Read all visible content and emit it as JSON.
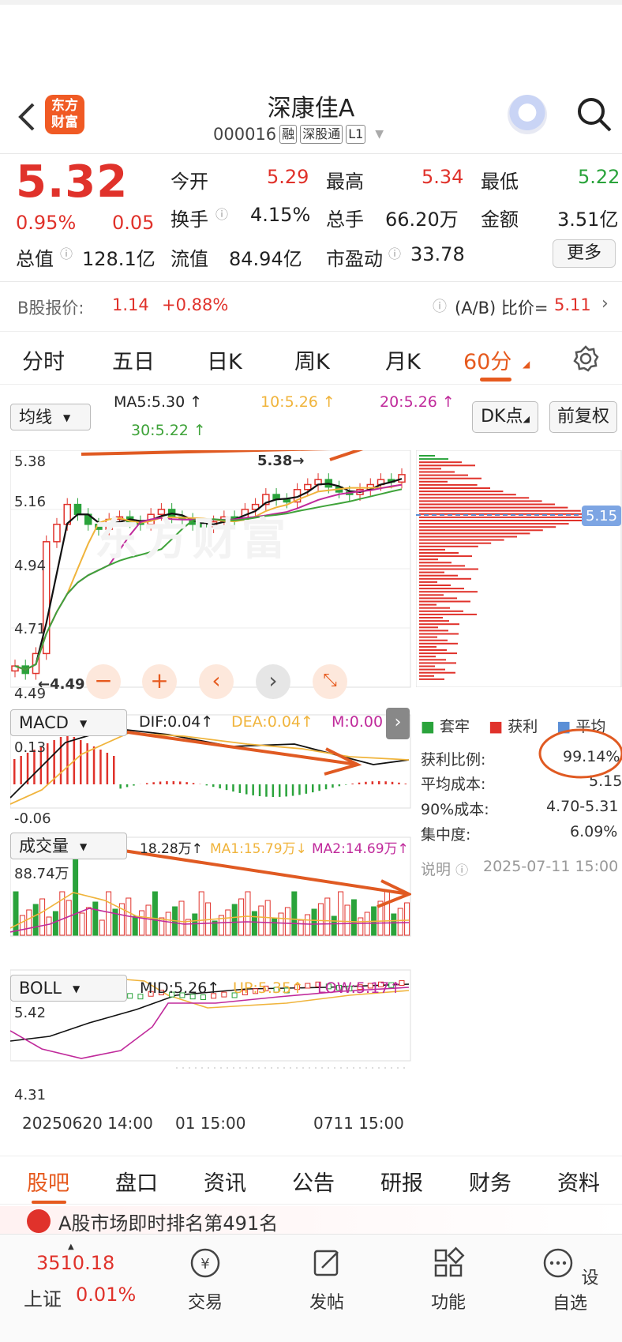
{
  "header": {
    "title": "深康佳A",
    "code": "000016",
    "tags": [
      "融",
      "深股通",
      "L1"
    ],
    "logo_lines": [
      "东方",
      "财富"
    ]
  },
  "quote": {
    "price": "5.32",
    "change_pct": "0.95%",
    "change": "0.05",
    "fields": [
      {
        "label": "今开",
        "value": "5.29",
        "color": "red"
      },
      {
        "label": "最高",
        "value": "5.34",
        "color": "red"
      },
      {
        "label": "最低",
        "value": "5.22",
        "color": "green"
      },
      {
        "label": "换手",
        "value": "4.15%",
        "color": "black"
      },
      {
        "label": "总手",
        "value": "66.20万",
        "color": "black"
      },
      {
        "label": "金额",
        "value": "3.51亿",
        "color": "black"
      },
      {
        "label": "总值",
        "value": "128.1亿",
        "color": "black"
      },
      {
        "label": "流值",
        "value": "84.94亿",
        "color": "black"
      },
      {
        "label": "市盈动",
        "value": "33.78",
        "color": "black"
      }
    ],
    "more_label": "更多"
  },
  "bshare": {
    "label": "B股报价:",
    "price": "1.14",
    "pct": "+0.88%",
    "ratio_label": "(A/B) 比价=",
    "ratio": "5.11"
  },
  "tabs": [
    "分时",
    "五日",
    "日K",
    "周K",
    "月K",
    "60分"
  ],
  "active_tab": "60分",
  "ma": {
    "selector": "均线",
    "ma5": "MA5:5.30",
    "ma10": "10:5.26",
    "ma20": "20:5.26",
    "ma30": "30:5.22",
    "dk": "DK点",
    "fq": "前复权"
  },
  "main_chart": {
    "ticks": [
      "5.38",
      "5.16",
      "4.94",
      "4.71",
      "4.49"
    ],
    "high_label": "5.38",
    "low_label": "4.49",
    "cost_line": "5.15",
    "watermark": "东方财富"
  },
  "macd": {
    "selector": "MACD",
    "dif": "DIF:0.04",
    "dea": "DEA:0.04",
    "m": "M:0.00",
    "top": "0.13",
    "bottom": "-0.06"
  },
  "volume": {
    "selector": "成交量",
    "vol": "18.28万",
    "ma1": "MA1:15.79万",
    "ma2": "MA2:14.69万",
    "top": "88.74万"
  },
  "boll": {
    "selector": "BOLL",
    "mid": "MID:5.26",
    "up": "UP:5.35",
    "low": "LOW:5.17",
    "top": "5.42",
    "bottom": "4.31"
  },
  "time_axis": [
    "20250620 14:00",
    "01 15:00",
    "0711 15:00"
  ],
  "chip": {
    "legend": [
      "套牢",
      "获利",
      "平均"
    ],
    "profit_label": "获利比例:",
    "profit": "99.14%",
    "avg_label": "平均成本:",
    "avg": "5.15",
    "c90_label": "90%成本:",
    "c90": "4.70-5.31",
    "conc_label": "集中度:",
    "conc": "6.09%",
    "note": "说明",
    "date": "2025-07-11 15:00"
  },
  "bottom_tabs": [
    "股吧",
    "盘口",
    "资讯",
    "公告",
    "研报",
    "财务",
    "资料"
  ],
  "ticker": "A股市场即时排名第491名",
  "footer": {
    "index_value": "3510.18",
    "index_name": "上证",
    "index_pct": "0.01%",
    "items": [
      "交易",
      "发帖",
      "功能",
      "设自选"
    ]
  },
  "colors": {
    "up": "#e0322b",
    "down": "#2aa33b",
    "accent": "#e65a1e",
    "ma10": "#f0b43c",
    "ma20": "#c02a9b",
    "ma30": "#3fa33a"
  },
  "chart_data": {
    "type": "line",
    "closes": [
      4.55,
      4.52,
      4.6,
      5.05,
      5.12,
      5.2,
      5.16,
      5.12,
      5.1,
      5.14,
      5.15,
      5.13,
      5.12,
      5.16,
      5.18,
      5.15,
      5.14,
      5.12,
      5.11,
      5.13,
      5.15,
      5.14,
      5.18,
      5.2,
      5.24,
      5.22,
      5.21,
      5.26,
      5.28,
      5.3,
      5.27,
      5.25,
      5.24,
      5.26,
      5.28,
      5.3,
      5.29,
      5.32
    ],
    "ylim": [
      4.49,
      5.38
    ]
  }
}
